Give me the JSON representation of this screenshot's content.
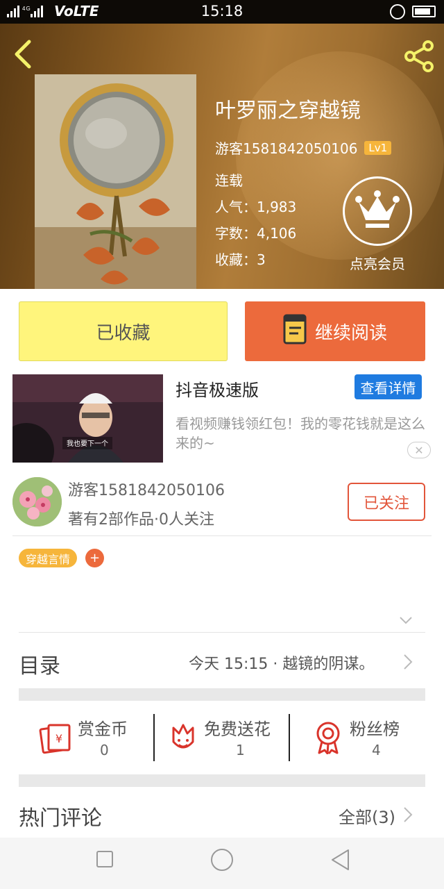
{
  "status_bar": {
    "time": "15:18",
    "network": "VoLTE",
    "signal": "4G"
  },
  "book": {
    "title": "叶罗丽之穿越镜",
    "author": "游客1581842050106",
    "level": "Lv1",
    "status": "连载",
    "popularity": "人气：1,983",
    "word_count": "字数：4,106",
    "favorites": "收藏：3",
    "vip_label": "点亮会员"
  },
  "actions": {
    "collected_label": "已收藏",
    "continue_label": "继续阅读"
  },
  "ad": {
    "title": "抖音极速版",
    "button": "查看详情",
    "description": "看视频赚钱领红包！我的零花钱就是这么来的~",
    "thumb_caption": "我也要下一个",
    "close": "✕"
  },
  "author_card": {
    "name": "游客1581842050106",
    "subtitle": "著有2部作品·0人关注",
    "follow_label": "已关注"
  },
  "tags": {
    "items": [
      "穿越言情"
    ],
    "add": "+"
  },
  "toc": {
    "label": "目录",
    "latest": "今天 15:15 · 越镜的阴谋。"
  },
  "stats": [
    {
      "label": "赏金币",
      "value": "0"
    },
    {
      "label": "免费送花",
      "value": "1"
    },
    {
      "label": "粉丝榜",
      "value": "4"
    }
  ],
  "comments": {
    "label": "热门评论",
    "all": "全部(3)"
  },
  "colors": {
    "accent_orange": "#ec6a3c",
    "collected_yellow": "#fff57c",
    "level_badge": "#f6b53b",
    "link_blue": "#1f7be0",
    "icon_red": "#d9342b"
  }
}
